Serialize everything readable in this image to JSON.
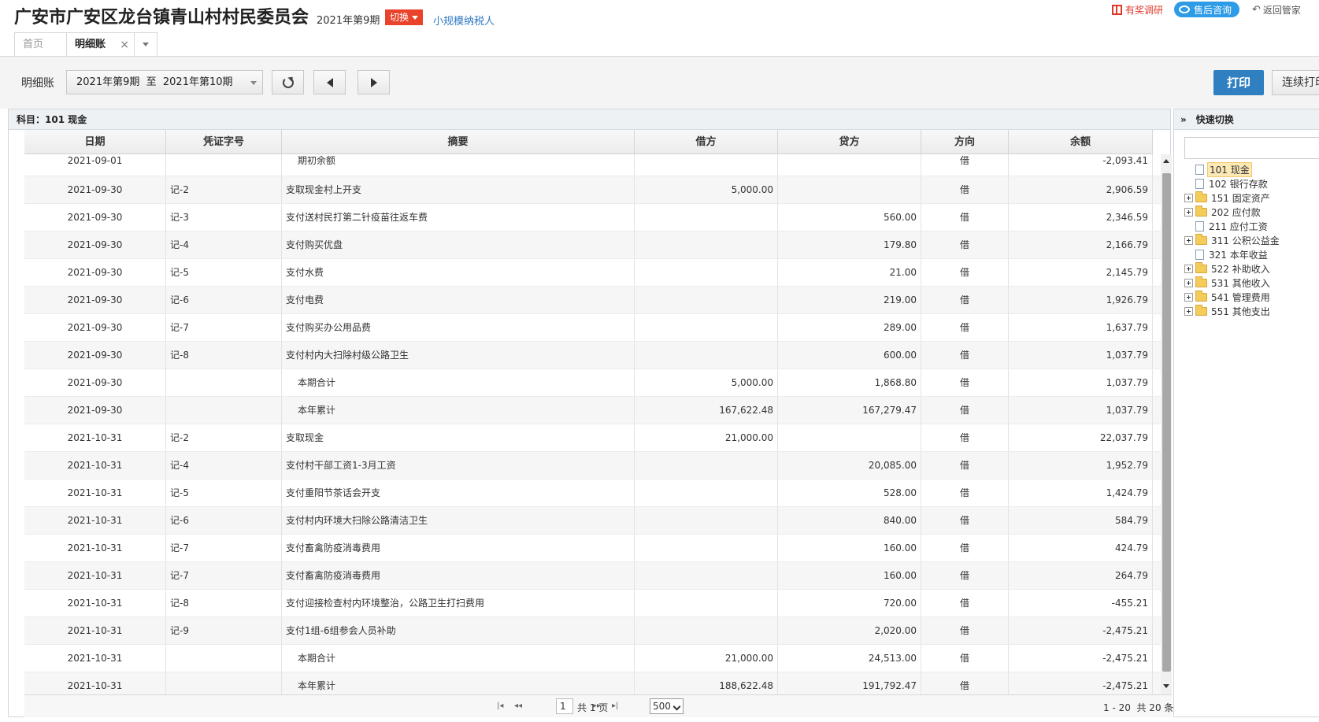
{
  "header": {
    "company": "广安市广安区龙台镇青山村村民委员会",
    "period": "2021年第9期",
    "switch_label": "切换",
    "taxpayer_type": "小规模纳税人",
    "survey_label": "有奖调研",
    "consult_label": "售后咨询",
    "back_label": "返回管家"
  },
  "tabs": {
    "home": "首页",
    "active": "明细账",
    "close": "×"
  },
  "toolbar": {
    "label": "明细账",
    "range": "2021年第9期  至  2021年第10期",
    "print_label": "打印",
    "continuous_print_label": "连续打印"
  },
  "subject": "科目：101  现金",
  "columns": [
    "日期",
    "凭证字号",
    "摘要",
    "借方",
    "贷方",
    "方向",
    "余额"
  ],
  "rows": [
    {
      "date": "2021-09-01",
      "voucher": "",
      "summary": "期初余额",
      "debit": "",
      "credit": "",
      "dir": "借",
      "balance": "-2,093.41",
      "indent": true
    },
    {
      "date": "2021-09-30",
      "voucher": "记-2",
      "summary": "支取现金村上开支",
      "debit": "5,000.00",
      "credit": "",
      "dir": "借",
      "balance": "2,906.59"
    },
    {
      "date": "2021-09-30",
      "voucher": "记-3",
      "summary": "支付送村民打第二针疫苗往返车费",
      "debit": "",
      "credit": "560.00",
      "dir": "借",
      "balance": "2,346.59"
    },
    {
      "date": "2021-09-30",
      "voucher": "记-4",
      "summary": "支付购买优盘",
      "debit": "",
      "credit": "179.80",
      "dir": "借",
      "balance": "2,166.79"
    },
    {
      "date": "2021-09-30",
      "voucher": "记-5",
      "summary": "支付水费",
      "debit": "",
      "credit": "21.00",
      "dir": "借",
      "balance": "2,145.79"
    },
    {
      "date": "2021-09-30",
      "voucher": "记-6",
      "summary": "支付电费",
      "debit": "",
      "credit": "219.00",
      "dir": "借",
      "balance": "1,926.79"
    },
    {
      "date": "2021-09-30",
      "voucher": "记-7",
      "summary": "支付购买办公用品费",
      "debit": "",
      "credit": "289.00",
      "dir": "借",
      "balance": "1,637.79"
    },
    {
      "date": "2021-09-30",
      "voucher": "记-8",
      "summary": "支付村内大扫除村级公路卫生",
      "debit": "",
      "credit": "600.00",
      "dir": "借",
      "balance": "1,037.79"
    },
    {
      "date": "2021-09-30",
      "voucher": "",
      "summary": "本期合计",
      "debit": "5,000.00",
      "credit": "1,868.80",
      "dir": "借",
      "balance": "1,037.79",
      "indent": true
    },
    {
      "date": "2021-09-30",
      "voucher": "",
      "summary": "本年累计",
      "debit": "167,622.48",
      "credit": "167,279.47",
      "dir": "借",
      "balance": "1,037.79",
      "indent": true
    },
    {
      "date": "2021-10-31",
      "voucher": "记-2",
      "summary": "支取现金",
      "debit": "21,000.00",
      "credit": "",
      "dir": "借",
      "balance": "22,037.79"
    },
    {
      "date": "2021-10-31",
      "voucher": "记-4",
      "summary": "支付村干部工资1-3月工资",
      "debit": "",
      "credit": "20,085.00",
      "dir": "借",
      "balance": "1,952.79"
    },
    {
      "date": "2021-10-31",
      "voucher": "记-5",
      "summary": "支付重阳节茶话会开支",
      "debit": "",
      "credit": "528.00",
      "dir": "借",
      "balance": "1,424.79"
    },
    {
      "date": "2021-10-31",
      "voucher": "记-6",
      "summary": "支付村内环境大扫除公路清洁卫生",
      "debit": "",
      "credit": "840.00",
      "dir": "借",
      "balance": "584.79"
    },
    {
      "date": "2021-10-31",
      "voucher": "记-7",
      "summary": "支付畜禽防疫消毒费用",
      "debit": "",
      "credit": "160.00",
      "dir": "借",
      "balance": "424.79"
    },
    {
      "date": "2021-10-31",
      "voucher": "记-7",
      "summary": "支付畜禽防疫消毒费用",
      "debit": "",
      "credit": "160.00",
      "dir": "借",
      "balance": "264.79"
    },
    {
      "date": "2021-10-31",
      "voucher": "记-8",
      "summary": "支付迎接检查村内环境整治，公路卫生打扫费用",
      "debit": "",
      "credit": "720.00",
      "dir": "借",
      "balance": "-455.21"
    },
    {
      "date": "2021-10-31",
      "voucher": "记-9",
      "summary": "支付1组-6组参会人员补助",
      "debit": "",
      "credit": "2,020.00",
      "dir": "借",
      "balance": "-2,475.21"
    },
    {
      "date": "2021-10-31",
      "voucher": "",
      "summary": "本期合计",
      "debit": "21,000.00",
      "credit": "24,513.00",
      "dir": "借",
      "balance": "-2,475.21",
      "indent": true
    },
    {
      "date": "2021-10-31",
      "voucher": "",
      "summary": "本年累计",
      "debit": "188,622.48",
      "credit": "191,792.47",
      "dir": "借",
      "balance": "-2,475.21",
      "indent": true
    }
  ],
  "pager": {
    "page": "1",
    "total_pages": "共 1 页",
    "page_size": "500",
    "range": "1 - 20  共 20 条"
  },
  "quick": {
    "title": "快速切换",
    "items": [
      {
        "code": "101 现金",
        "type": "file",
        "selected": true
      },
      {
        "code": "102 银行存款",
        "type": "file"
      },
      {
        "code": "151 固定资产",
        "type": "folder"
      },
      {
        "code": "202 应付款",
        "type": "folder"
      },
      {
        "code": "211 应付工资",
        "type": "file"
      },
      {
        "code": "311 公积公益金",
        "type": "folder"
      },
      {
        "code": "321 本年收益",
        "type": "file"
      },
      {
        "code": "522 补助收入",
        "type": "folder"
      },
      {
        "code": "531 其他收入",
        "type": "folder"
      },
      {
        "code": "541 管理费用",
        "type": "folder"
      },
      {
        "code": "551 其他支出",
        "type": "folder"
      }
    ]
  }
}
